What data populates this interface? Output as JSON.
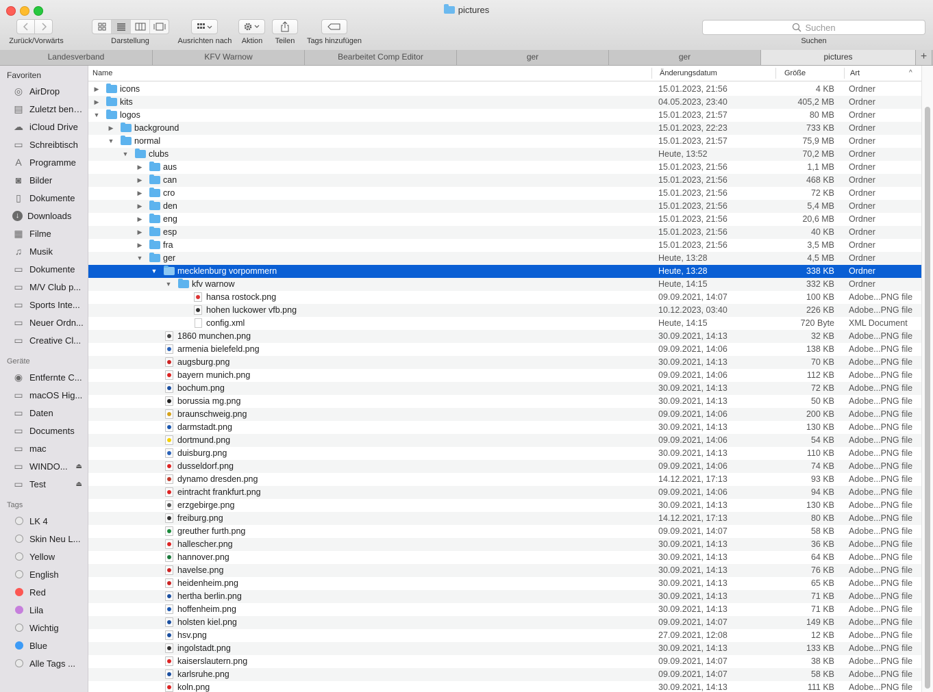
{
  "window": {
    "title": "pictures"
  },
  "toolbar": {
    "back_forward_label": "Zurück/Vorwärts",
    "view_label": "Darstellung",
    "arrange_label": "Ausrichten nach",
    "action_label": "Aktion",
    "share_label": "Teilen",
    "tags_label": "Tags hinzufügen",
    "search_label": "Suchen",
    "search_placeholder": "Suchen"
  },
  "tabs": [
    "Landesverband",
    "KFV Warnow",
    "Bearbeitet Comp Editor",
    "ger",
    "ger",
    "pictures"
  ],
  "sidebar": {
    "favorites_title": "Favoriten",
    "favorites": [
      {
        "label": "AirDrop",
        "icon": "airdrop-icon"
      },
      {
        "label": "Zuletzt benutzt",
        "icon": "recents-icon"
      },
      {
        "label": "iCloud Drive",
        "icon": "cloud-icon"
      },
      {
        "label": "Schreibtisch",
        "icon": "desktop-icon"
      },
      {
        "label": "Programme",
        "icon": "applications-icon"
      },
      {
        "label": "Bilder",
        "icon": "camera-icon"
      },
      {
        "label": "Dokumente",
        "icon": "document-icon"
      },
      {
        "label": "Downloads",
        "icon": "download-icon"
      },
      {
        "label": "Filme",
        "icon": "film-icon"
      },
      {
        "label": "Musik",
        "icon": "music-icon"
      },
      {
        "label": "Dokumente",
        "icon": "folder-icon"
      },
      {
        "label": "M/V Club p...",
        "icon": "folder-icon"
      },
      {
        "label": "Sports Inte...",
        "icon": "folder-icon"
      },
      {
        "label": "Neuer Ordn...",
        "icon": "folder-icon"
      },
      {
        "label": "Creative Cl...",
        "icon": "folder-icon"
      }
    ],
    "devices_title": "Geräte",
    "devices": [
      {
        "label": "Entfernte C...",
        "icon": "disc-icon",
        "eject": false
      },
      {
        "label": "macOS Hig...",
        "icon": "drive-icon",
        "eject": false
      },
      {
        "label": "Daten",
        "icon": "drive-icon",
        "eject": false
      },
      {
        "label": "Documents",
        "icon": "drive-icon",
        "eject": false
      },
      {
        "label": "mac",
        "icon": "drive-icon",
        "eject": false
      },
      {
        "label": "WINDO...",
        "icon": "drive-icon",
        "eject": true
      },
      {
        "label": "Test",
        "icon": "drive-icon",
        "eject": true
      }
    ],
    "tags_title": "Tags",
    "tags": [
      {
        "label": "LK 4",
        "color": ""
      },
      {
        "label": "Skin Neu L...",
        "color": ""
      },
      {
        "label": "Yellow",
        "color": ""
      },
      {
        "label": "English",
        "color": ""
      },
      {
        "label": "Red",
        "color": "#fc5753"
      },
      {
        "label": "Lila",
        "color": "#c67fdc"
      },
      {
        "label": "Wichtig",
        "color": ""
      },
      {
        "label": "Blue",
        "color": "#3d9bf6"
      },
      {
        "label": "Alle Tags ...",
        "color": ""
      }
    ]
  },
  "columns": {
    "name": "Name",
    "date": "Änderungsdatum",
    "size": "Größe",
    "kind": "Art",
    "sort_arrow": "^"
  },
  "colors": {
    "selection": "#0a5fd4",
    "folder": "#5db3ee"
  },
  "rows": [
    {
      "name": "icons",
      "date": "15.01.2023, 21:56",
      "size": "4 KB",
      "kind": "Ordner",
      "level": 0,
      "type": "folder",
      "open": false
    },
    {
      "name": "kits",
      "date": "04.05.2023, 23:40",
      "size": "405,2 MB",
      "kind": "Ordner",
      "level": 0,
      "type": "folder",
      "open": false
    },
    {
      "name": "logos",
      "date": "15.01.2023, 21:57",
      "size": "80 MB",
      "kind": "Ordner",
      "level": 0,
      "type": "folder",
      "open": true
    },
    {
      "name": "background",
      "date": "15.01.2023, 22:23",
      "size": "733 KB",
      "kind": "Ordner",
      "level": 1,
      "type": "folder",
      "open": false
    },
    {
      "name": "normal",
      "date": "15.01.2023, 21:57",
      "size": "75,9 MB",
      "kind": "Ordner",
      "level": 1,
      "type": "folder",
      "open": true
    },
    {
      "name": "clubs",
      "date": "Heute, 13:52",
      "size": "70,2 MB",
      "kind": "Ordner",
      "level": 2,
      "type": "folder",
      "open": true
    },
    {
      "name": "aus",
      "date": "15.01.2023, 21:56",
      "size": "1,1 MB",
      "kind": "Ordner",
      "level": 3,
      "type": "folder",
      "open": false
    },
    {
      "name": "can",
      "date": "15.01.2023, 21:56",
      "size": "468 KB",
      "kind": "Ordner",
      "level": 3,
      "type": "folder",
      "open": false
    },
    {
      "name": "cro",
      "date": "15.01.2023, 21:56",
      "size": "72 KB",
      "kind": "Ordner",
      "level": 3,
      "type": "folder",
      "open": false
    },
    {
      "name": "den",
      "date": "15.01.2023, 21:56",
      "size": "5,4 MB",
      "kind": "Ordner",
      "level": 3,
      "type": "folder",
      "open": false
    },
    {
      "name": "eng",
      "date": "15.01.2023, 21:56",
      "size": "20,6 MB",
      "kind": "Ordner",
      "level": 3,
      "type": "folder",
      "open": false
    },
    {
      "name": "esp",
      "date": "15.01.2023, 21:56",
      "size": "40 KB",
      "kind": "Ordner",
      "level": 3,
      "type": "folder",
      "open": false
    },
    {
      "name": "fra",
      "date": "15.01.2023, 21:56",
      "size": "3,5 MB",
      "kind": "Ordner",
      "level": 3,
      "type": "folder",
      "open": false
    },
    {
      "name": "ger",
      "date": "Heute, 13:28",
      "size": "4,5 MB",
      "kind": "Ordner",
      "level": 3,
      "type": "folder",
      "open": true
    },
    {
      "name": "mecklenburg vorpommern",
      "date": "Heute, 13:28",
      "size": "338 KB",
      "kind": "Ordner",
      "level": 4,
      "type": "folder",
      "open": true,
      "selected": true
    },
    {
      "name": "kfv warnow",
      "date": "Heute, 14:15",
      "size": "332 KB",
      "kind": "Ordner",
      "level": 5,
      "type": "folder",
      "open": true
    },
    {
      "name": "hansa rostock.png",
      "date": "09.09.2021, 14:07",
      "size": "100 KB",
      "kind": "Adobe...PNG file",
      "level": 6,
      "type": "png",
      "tint": "#d33"
    },
    {
      "name": "hohen luckower vfb.png",
      "date": "10.12.2023, 03:40",
      "size": "226 KB",
      "kind": "Adobe...PNG file",
      "level": 6,
      "type": "png",
      "tint": "#333"
    },
    {
      "name": "config.xml",
      "date": "Heute, 14:15",
      "size": "720 Byte",
      "kind": "XML Document",
      "level": 6,
      "type": "xml"
    },
    {
      "name": "1860 munchen.png",
      "date": "30.09.2021, 14:13",
      "size": "32 KB",
      "kind": "Adobe...PNG file",
      "level": 4,
      "type": "png",
      "tint": "#444"
    },
    {
      "name": "armenia bielefeld.png",
      "date": "09.09.2021, 14:06",
      "size": "138 KB",
      "kind": "Adobe...PNG file",
      "level": 4,
      "type": "png",
      "tint": "#2a62b8"
    },
    {
      "name": "augsburg.png",
      "date": "30.09.2021, 14:13",
      "size": "70 KB",
      "kind": "Adobe...PNG file",
      "level": 4,
      "type": "png",
      "tint": "#c22"
    },
    {
      "name": "bayern munich.png",
      "date": "09.09.2021, 14:06",
      "size": "112 KB",
      "kind": "Adobe...PNG file",
      "level": 4,
      "type": "png",
      "tint": "#d22"
    },
    {
      "name": "bochum.png",
      "date": "30.09.2021, 14:13",
      "size": "72 KB",
      "kind": "Adobe...PNG file",
      "level": 4,
      "type": "png",
      "tint": "#1b4fa0"
    },
    {
      "name": "borussia mg.png",
      "date": "30.09.2021, 14:13",
      "size": "50 KB",
      "kind": "Adobe...PNG file",
      "level": 4,
      "type": "png",
      "tint": "#222"
    },
    {
      "name": "braunschweig.png",
      "date": "09.09.2021, 14:06",
      "size": "200 KB",
      "kind": "Adobe...PNG file",
      "level": 4,
      "type": "png",
      "tint": "#d6a218"
    },
    {
      "name": "darmstadt.png",
      "date": "30.09.2021, 14:13",
      "size": "130 KB",
      "kind": "Adobe...PNG file",
      "level": 4,
      "type": "png",
      "tint": "#1a57b0"
    },
    {
      "name": "dortmund.png",
      "date": "09.09.2021, 14:06",
      "size": "54 KB",
      "kind": "Adobe...PNG file",
      "level": 4,
      "type": "png",
      "tint": "#f5d000"
    },
    {
      "name": "duisburg.png",
      "date": "30.09.2021, 14:13",
      "size": "110 KB",
      "kind": "Adobe...PNG file",
      "level": 4,
      "type": "png",
      "tint": "#2a62b8"
    },
    {
      "name": "dusseldorf.png",
      "date": "09.09.2021, 14:06",
      "size": "74 KB",
      "kind": "Adobe...PNG file",
      "level": 4,
      "type": "png",
      "tint": "#d22"
    },
    {
      "name": "dynamo dresden.png",
      "date": "14.12.2021, 17:13",
      "size": "93 KB",
      "kind": "Adobe...PNG file",
      "level": 4,
      "type": "png",
      "tint": "#c0392b"
    },
    {
      "name": "eintracht frankfurt.png",
      "date": "09.09.2021, 14:06",
      "size": "94 KB",
      "kind": "Adobe...PNG file",
      "level": 4,
      "type": "png",
      "tint": "#d22"
    },
    {
      "name": "erzgebirge.png",
      "date": "30.09.2021, 14:13",
      "size": "130 KB",
      "kind": "Adobe...PNG file",
      "level": 4,
      "type": "png",
      "tint": "#555"
    },
    {
      "name": "freiburg.png",
      "date": "14.12.2021, 17:13",
      "size": "80 KB",
      "kind": "Adobe...PNG file",
      "level": 4,
      "type": "png",
      "tint": "#333"
    },
    {
      "name": "greuther furth.png",
      "date": "09.09.2021, 14:07",
      "size": "58 KB",
      "kind": "Adobe...PNG file",
      "level": 4,
      "type": "png",
      "tint": "#1a8a3a"
    },
    {
      "name": "hallescher.png",
      "date": "30.09.2021, 14:13",
      "size": "36 KB",
      "kind": "Adobe...PNG file",
      "level": 4,
      "type": "png",
      "tint": "#d22"
    },
    {
      "name": "hannover.png",
      "date": "30.09.2021, 14:13",
      "size": "64 KB",
      "kind": "Adobe...PNG file",
      "level": 4,
      "type": "png",
      "tint": "#1a7a3a"
    },
    {
      "name": "havelse.png",
      "date": "30.09.2021, 14:13",
      "size": "76 KB",
      "kind": "Adobe...PNG file",
      "level": 4,
      "type": "png",
      "tint": "#c22"
    },
    {
      "name": "heidenheim.png",
      "date": "30.09.2021, 14:13",
      "size": "65 KB",
      "kind": "Adobe...PNG file",
      "level": 4,
      "type": "png",
      "tint": "#c22"
    },
    {
      "name": "hertha berlin.png",
      "date": "30.09.2021, 14:13",
      "size": "71 KB",
      "kind": "Adobe...PNG file",
      "level": 4,
      "type": "png",
      "tint": "#1a4fa0"
    },
    {
      "name": "hoffenheim.png",
      "date": "30.09.2021, 14:13",
      "size": "71 KB",
      "kind": "Adobe...PNG file",
      "level": 4,
      "type": "png",
      "tint": "#1a57b0"
    },
    {
      "name": "holsten kiel.png",
      "date": "09.09.2021, 14:07",
      "size": "149 KB",
      "kind": "Adobe...PNG file",
      "level": 4,
      "type": "png",
      "tint": "#1a4fa0"
    },
    {
      "name": "hsv.png",
      "date": "27.09.2021, 12:08",
      "size": "12 KB",
      "kind": "Adobe...PNG file",
      "level": 4,
      "type": "png",
      "tint": "#1a4fa0"
    },
    {
      "name": "ingolstadt.png",
      "date": "30.09.2021, 14:13",
      "size": "133 KB",
      "kind": "Adobe...PNG file",
      "level": 4,
      "type": "png",
      "tint": "#333"
    },
    {
      "name": "kaiserslautern.png",
      "date": "09.09.2021, 14:07",
      "size": "38 KB",
      "kind": "Adobe...PNG file",
      "level": 4,
      "type": "png",
      "tint": "#d22"
    },
    {
      "name": "karlsruhe.png",
      "date": "09.09.2021, 14:07",
      "size": "58 KB",
      "kind": "Adobe...PNG file",
      "level": 4,
      "type": "png",
      "tint": "#1a4fa0"
    },
    {
      "name": "koln.png",
      "date": "30.09.2021, 14:13",
      "size": "111 KB",
      "kind": "Adobe...PNG file",
      "level": 4,
      "type": "png",
      "tint": "#d22"
    }
  ]
}
